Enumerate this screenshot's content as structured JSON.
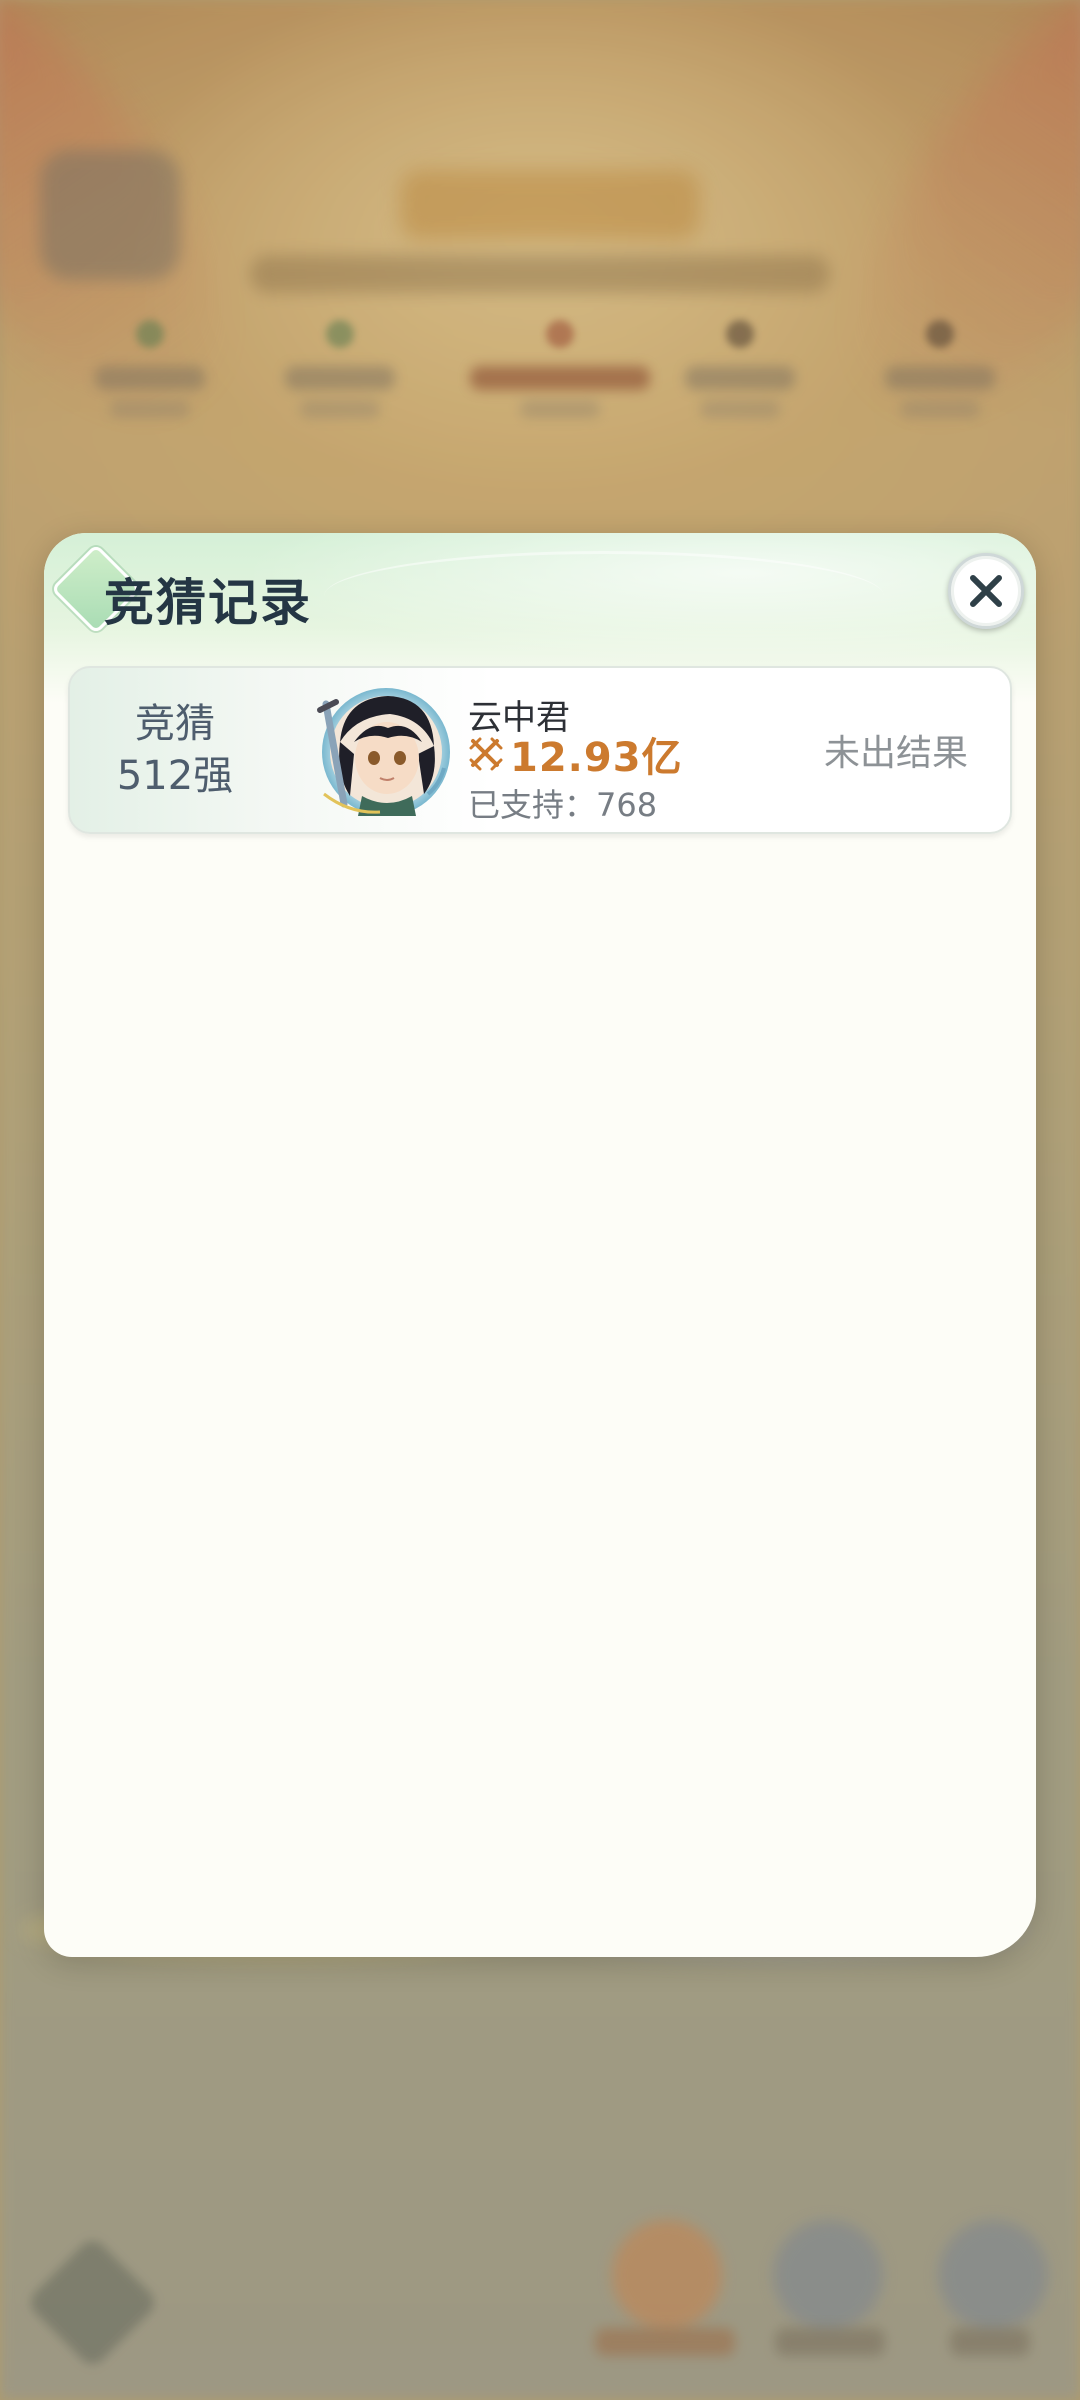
{
  "dialog": {
    "title": "竞猜记录",
    "close_icon": "close-icon"
  },
  "records": [
    {
      "round_label": "竞猜",
      "round_stage": "512强",
      "hero_name": "云中君",
      "power_icon": "crossed-swords-icon",
      "power_value": "12.93亿",
      "support_text": "已支持：768",
      "result": "未出结果"
    }
  ],
  "colors": {
    "power": "#cc7a2e",
    "title": "#243644",
    "modal_bg": "#fdfdf7",
    "header_tint": "#d5f0d7"
  }
}
